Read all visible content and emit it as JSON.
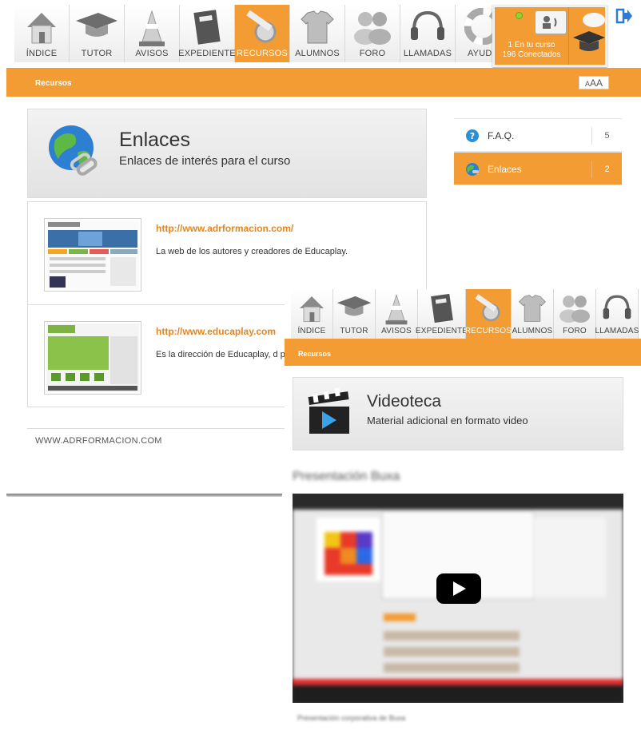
{
  "main": {
    "nav": [
      {
        "id": "indice",
        "label": "ÍNDICE",
        "icon": "house-icon"
      },
      {
        "id": "tutor",
        "label": "TUTOR",
        "icon": "graduation-cap-icon"
      },
      {
        "id": "avisos",
        "label": "AVISOS",
        "icon": "traffic-cone-icon"
      },
      {
        "id": "expediente",
        "label": "EXPEDIENTE",
        "icon": "folder-icon"
      },
      {
        "id": "recursos",
        "label": "RECURSOS",
        "icon": "tools-icon",
        "active": true
      },
      {
        "id": "alumnos",
        "label": "ALUMNOS",
        "icon": "tshirt-icon"
      },
      {
        "id": "foro",
        "label": "FORO",
        "icon": "people-icon"
      },
      {
        "id": "llamadas",
        "label": "LLAMADAS",
        "icon": "headset-icon"
      },
      {
        "id": "ayuda",
        "label": "AYUDA",
        "icon": "lifebuoy-icon"
      }
    ],
    "status": {
      "line1": "1  En tu curso",
      "line2": "196 Conectados"
    },
    "breadcrumb": "Recursos",
    "font_size_btn": {
      "small": "A",
      "big": "AA"
    },
    "header": {
      "title": "Enlaces",
      "subtitle": "Enlaces de interés para el curso"
    },
    "links": [
      {
        "url": "http://www.adrformacion.com/",
        "desc": "La web de los autores y creadores de Educaplay."
      },
      {
        "url": "http://www.educaplay.com",
        "desc": "Es la dirección de Educaplay, d participar en la plataforma."
      }
    ],
    "footer": "WWW.ADRFORMACION.COM",
    "side_menu": [
      {
        "label": "F.A.Q.",
        "count": "5",
        "icon": "help-icon"
      },
      {
        "label": "Enlaces",
        "count": "2",
        "icon": "globe-link-icon",
        "active": true
      }
    ]
  },
  "overlay": {
    "nav": [
      {
        "label": "ÍNDICE"
      },
      {
        "label": "TUTOR"
      },
      {
        "label": "AVISOS"
      },
      {
        "label": "EXPEDIENTE"
      },
      {
        "label": "RECURSOS",
        "active": true
      },
      {
        "label": "ALUMNOS"
      },
      {
        "label": "FORO"
      },
      {
        "label": "LLAMADAS"
      }
    ],
    "breadcrumb": "Recursos",
    "header": {
      "title": "Videoteca",
      "subtitle": "Material adicional en formato video"
    },
    "video_title": "Presentación Buxa",
    "video_caption": "Presentación corporativa de Buxa"
  },
  "colors": {
    "accent": "#f39c34",
    "link": "#e38620"
  }
}
